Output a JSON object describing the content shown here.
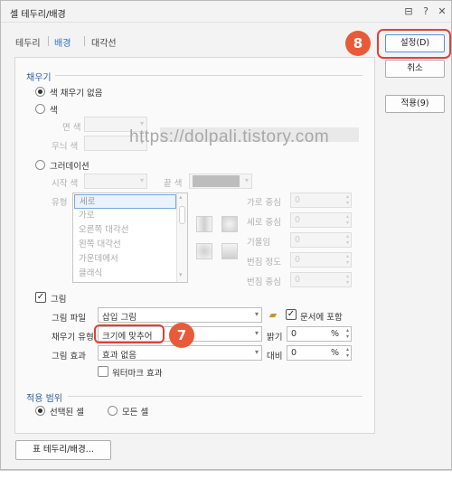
{
  "window": {
    "title": "셀 테두리/배경",
    "controls": [
      "board-icon",
      "help-icon",
      "close-icon"
    ],
    "control_glyphs": [
      "⊟",
      "?",
      "✕"
    ]
  },
  "tabs": [
    {
      "label": "테두리",
      "active": false
    },
    {
      "label": "배경",
      "active": true
    },
    {
      "label": "대각선",
      "active": false
    }
  ],
  "fill": {
    "section_title": "채우기",
    "no_fill_label": "색 채우기 없음",
    "color_label": "색",
    "face_color_label": "면 색",
    "pattern_color_label": "무늬 색",
    "gradation_label": "그러데이션",
    "start_color_label": "시작 색",
    "end_color_label": "끝 색",
    "type_label": "유형",
    "gradient_types": [
      "세로",
      "가로",
      "오른쪽 대각선",
      "왼쪽 대각선",
      "가운데에서",
      "클래식"
    ],
    "h_center_label": "가로 중심",
    "v_center_label": "세로 중심",
    "tilt_label": "기울임",
    "blur_degree_label": "번짐 정도",
    "blur_center_label": "번짐 중심",
    "h_center_value": "0",
    "v_center_value": "0",
    "tilt_value": "0",
    "blur_degree_value": "0",
    "blur_center_value": "0"
  },
  "picture": {
    "checkbox_label": "그림",
    "checked": true,
    "file_label": "그림 파일",
    "file_value": "삽입 그림",
    "embed_label": "문서에 포함",
    "embed_checked": true,
    "fill_type_label": "채우기 유형",
    "fill_type_value": "크기에 맞추어",
    "brightness_label": "밝기",
    "brightness_value": "0",
    "effect_label": "그림 효과",
    "effect_value": "효과 없음",
    "contrast_label": "대비",
    "contrast_value": "0",
    "percent_unit": "%",
    "watermark_label": "워터마크 효과"
  },
  "apply_range": {
    "section_title": "적용 범위",
    "selected_cells_label": "선택된 셀",
    "all_cells_label": "모든 셀"
  },
  "buttons": {
    "set": "설정(D)",
    "cancel": "취소",
    "apply": "적용(9)",
    "table_border": "표 테두리/배경..."
  },
  "annotations": {
    "badge_7": "7",
    "badge_8": "8",
    "watermark_text": "https://dolpali.tistory.com"
  },
  "colors": {
    "accent": "#2f6fd1",
    "section": "#2d5fa8",
    "badge": "#e85a3a",
    "highlight": "#e0403a"
  }
}
